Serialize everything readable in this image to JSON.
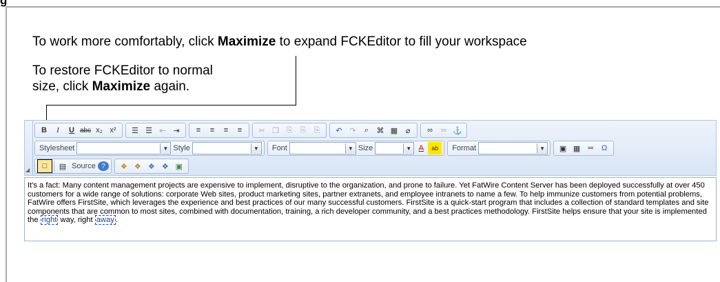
{
  "heading": "g",
  "callouts": {
    "maximize_pre": "To work more comfortably, click ",
    "maximize_bold": "Maximize",
    "maximize_post": " to expand FCKEditor to fill your workspace",
    "restore_pre": "To restore FCKEditor to normal size, click ",
    "restore_bold": "Maximize",
    "restore_post": " again."
  },
  "toolbar": {
    "row1": {
      "bold": "B",
      "italic": "I",
      "underline": "U",
      "strike": "abc",
      "subscript": "x₂",
      "superscript": "x²",
      "ordered_list": "☰",
      "unordered_list": "☰",
      "outdent": "⇤",
      "indent": "⇥",
      "align_left": "≡",
      "align_center": "≡",
      "align_right": "≡",
      "justify": "≡",
      "cut": "✂",
      "copy": "❐",
      "paste": "⎘",
      "paste_text": "⎘",
      "paste_word": "⎘",
      "undo": "↶",
      "redo": "↷",
      "find": "⌕",
      "replace": "⌘",
      "select_all": "▦",
      "remove_format": "⌀",
      "link": "∞",
      "unlink": "∞",
      "anchor": "⚓"
    },
    "row2": {
      "stylesheet_label": "Stylesheet",
      "style_label": "Style",
      "font_label": "Font",
      "size_label": "Size",
      "format_label": "Format",
      "text_color": "A",
      "bg_color": "ab",
      "image": "▣",
      "table": "▦",
      "rule": "═",
      "special_char": "Ω"
    },
    "row3": {
      "maximize": "□",
      "source_icon": "▤",
      "source_label": "Source",
      "help": "?",
      "b1": "❖",
      "b2": "❖",
      "b3": "❖",
      "b4": "❖",
      "b5": "▣"
    }
  },
  "content": {
    "text": "It's a fact: Many content management projects are expensive to implement, disruptive to the organization, and prone to failure. Yet FatWire Content Server has been deployed successfully at over 450 customers for a wide range of solutions: corporate Web sites, product marketing sites, partner extranets, and employee intranets to name a few. To help immunize customers from potential problems, FatWire offers FirstSite, which leverages the experience and best practices of our many successful customers. FirstSite is a quick-start program that includes a collection of standard templates and site components that are common to most sites, combined with documentation, training, a rich developer community, and a best practices methodology. FirstSite helps ensure that your site is implemented the ",
    "link1": "right",
    "mid": " way, right ",
    "link2": "away",
    "end": "."
  }
}
